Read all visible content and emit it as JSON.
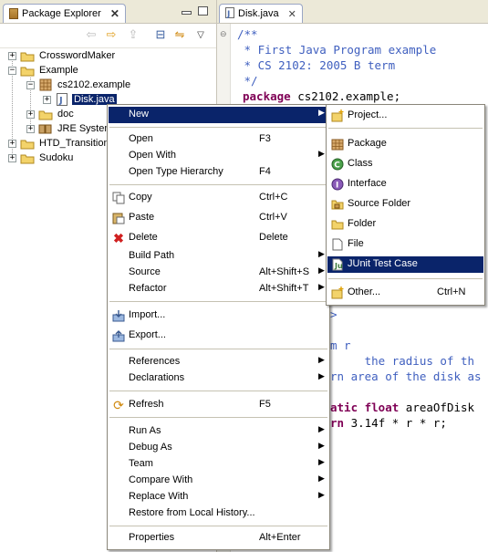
{
  "package_explorer": {
    "tab_title": "Package Explorer",
    "tree": [
      {
        "label": "CrosswordMaker",
        "expander": "+",
        "icon": "project-folder-icon"
      },
      {
        "label": "Example",
        "expander": "−",
        "icon": "project-folder-icon"
      },
      {
        "label": "cs2102.example",
        "expander": "−",
        "icon": "package-icon"
      },
      {
        "label": "Disk.java",
        "expander": "+",
        "icon": "java-file-icon",
        "selected": true
      },
      {
        "label": "doc",
        "expander": "+",
        "icon": "doc-folder-icon"
      },
      {
        "label": "JRE System",
        "expander": "+",
        "icon": "jre-library-icon"
      },
      {
        "label": "HTD_Transition",
        "expander": "+",
        "icon": "project-folder-icon"
      },
      {
        "label": "Sudoku",
        "expander": "+",
        "icon": "project-folder-icon"
      }
    ]
  },
  "editor": {
    "tab_title": "Disk.java",
    "lines_top": [
      {
        "t": "/**",
        "style": "cmt"
      },
      {
        "t": " * First Java Program example",
        "style": "cmt"
      },
      {
        "t": " * CS 2102: 2005 B term",
        "style": "cmt"
      },
      {
        "t": " */",
        "style": "cmt"
      }
    ],
    "pkg_kw": "package",
    "pkg_name": " cs2102.example;",
    "lines_bottom": [
      {
        "t": ">",
        "style": "cmt"
      },
      {
        "t": "m r",
        "style": "cmt"
      },
      {
        "t": "     the radius of th",
        "style": "cmt"
      },
      {
        "t": "rn area of the disk as",
        "style": "cmt"
      }
    ],
    "decl_kw": "atic float",
    "decl_rest": " areaOfDisk",
    "ret_kw": "rn",
    "ret_rest": " 3.14f * r * r;"
  },
  "context_menu": {
    "groups": [
      [
        {
          "label": "New",
          "submenu": true,
          "highlight": true
        }
      ],
      [
        {
          "label": "Open",
          "accel": "F3"
        },
        {
          "label": "Open With",
          "submenu": true
        },
        {
          "label": "Open Type Hierarchy",
          "accel": "F4"
        }
      ],
      [
        {
          "label": "Copy",
          "accel": "Ctrl+C",
          "icon": "copy-icon"
        },
        {
          "label": "Paste",
          "accel": "Ctrl+V",
          "icon": "paste-icon"
        },
        {
          "label": "Delete",
          "accel": "Delete",
          "icon": "delete-icon"
        },
        {
          "label": "Build Path",
          "submenu": true
        },
        {
          "label": "Source",
          "accel": "Alt+Shift+S",
          "submenu": true
        },
        {
          "label": "Refactor",
          "accel": "Alt+Shift+T",
          "submenu": true
        }
      ],
      [
        {
          "label": "Import...",
          "icon": "import-icon"
        },
        {
          "label": "Export...",
          "icon": "export-icon"
        }
      ],
      [
        {
          "label": "References",
          "submenu": true
        },
        {
          "label": "Declarations",
          "submenu": true
        }
      ],
      [
        {
          "label": "Refresh",
          "accel": "F5",
          "icon": "refresh-icon"
        }
      ],
      [
        {
          "label": "Run As",
          "submenu": true
        },
        {
          "label": "Debug As",
          "submenu": true
        },
        {
          "label": "Team",
          "submenu": true
        },
        {
          "label": "Compare With",
          "submenu": true
        },
        {
          "label": "Replace With",
          "submenu": true
        },
        {
          "label": "Restore from Local History..."
        }
      ],
      [
        {
          "label": "Properties",
          "accel": "Alt+Enter"
        }
      ]
    ]
  },
  "new_submenu": {
    "groups": [
      [
        {
          "label": "Project...",
          "icon": "new-project-icon"
        }
      ],
      [
        {
          "label": "Package",
          "icon": "package-icon"
        },
        {
          "label": "Class",
          "icon": "class-icon"
        },
        {
          "label": "Interface",
          "icon": "interface-icon"
        },
        {
          "label": "Source Folder",
          "icon": "source-folder-icon"
        },
        {
          "label": "Folder",
          "icon": "folder-icon"
        },
        {
          "label": "File",
          "icon": "file-icon"
        },
        {
          "label": "JUnit Test Case",
          "icon": "junit-icon",
          "highlight": true
        }
      ],
      [
        {
          "label": "Other...",
          "accel": "Ctrl+N",
          "icon": "other-icon"
        }
      ]
    ]
  },
  "colors": {
    "selection": "#0a246a",
    "comment": "#3f5fbf",
    "keyword": "#7f0055"
  }
}
